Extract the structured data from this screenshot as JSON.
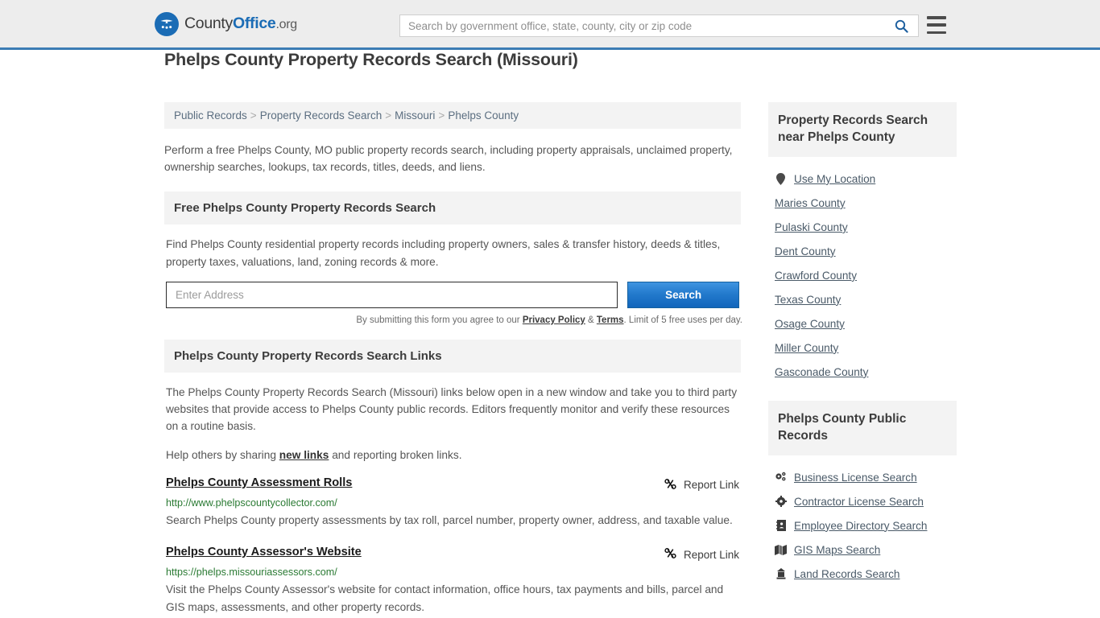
{
  "header": {
    "logo": {
      "part1": "County",
      "part2": "Office",
      "part3": ".org",
      "icon": "eagle-seal-icon"
    },
    "search_placeholder": "Search by government office, state, county, city or zip code",
    "search_value": "",
    "search_icon": "search-icon",
    "menu_icon": "hamburger-menu-icon"
  },
  "page": {
    "title": "Phelps County Property Records Search (Missouri)",
    "breadcrumb": [
      {
        "label": "Public Records"
      },
      {
        "label": "Property Records Search"
      },
      {
        "label": "Missouri"
      },
      {
        "label": "Phelps County"
      }
    ],
    "breadcrumb_separator": ">",
    "intro": "Perform a free Phelps County, MO public property records search, including property appraisals, unclaimed property, ownership searches, lookups, tax records, titles, deeds, and liens."
  },
  "free_search": {
    "heading": "Free Phelps County Property Records Search",
    "description": "Find Phelps County residential property records including property owners, sales & transfer history, deeds & titles, property taxes, valuations, land, zoning records & more.",
    "input_placeholder": "Enter Address",
    "input_value": "",
    "button_label": "Search",
    "note_prefix": "By submitting this form you agree to our ",
    "note_privacy": "Privacy Policy",
    "note_amp": " & ",
    "note_terms": "Terms",
    "note_suffix": ". Limit of 5 free uses per day."
  },
  "links_section": {
    "heading": "Phelps County Property Records Search Links",
    "paragraph": "The Phelps County Property Records Search (Missouri) links below open in a new window and take you to third party websites that provide access to Phelps County public records. Editors frequently monitor and verify these resources on a routine basis.",
    "share_prefix": "Help others by sharing ",
    "share_link": "new links",
    "share_suffix": " and reporting broken links.",
    "report_label": "Report Link",
    "report_icon": "broken-link-icon",
    "results": [
      {
        "title": "Phelps County Assessment Rolls",
        "url": "http://www.phelpscountycollector.com/",
        "description": "Search Phelps County property assessments by tax roll, parcel number, property owner, address, and taxable value."
      },
      {
        "title": "Phelps County Assessor's Website",
        "url": "https://phelps.missouriassessors.com/",
        "description": "Visit the Phelps County Assessor's website for contact information, office hours, tax payments and bills, parcel and GIS maps, assessments, and other property records."
      }
    ]
  },
  "sidebar": {
    "nearby": {
      "heading": "Property Records Search near Phelps County",
      "items": [
        {
          "label": "Use My Location",
          "icon": "map-pin-icon"
        },
        {
          "label": "Maries County",
          "icon": ""
        },
        {
          "label": "Pulaski County",
          "icon": ""
        },
        {
          "label": "Dent County",
          "icon": ""
        },
        {
          "label": "Crawford County",
          "icon": ""
        },
        {
          "label": "Texas County",
          "icon": ""
        },
        {
          "label": "Osage County",
          "icon": ""
        },
        {
          "label": "Miller County",
          "icon": ""
        },
        {
          "label": "Gasconade County",
          "icon": ""
        }
      ]
    },
    "public_records": {
      "heading": "Phelps County Public Records",
      "items": [
        {
          "label": "Business License Search",
          "icon": "cogs-icon"
        },
        {
          "label": "Contractor License Search",
          "icon": "cog-icon"
        },
        {
          "label": "Employee Directory Search",
          "icon": "address-book-icon"
        },
        {
          "label": "GIS Maps Search",
          "icon": "map-icon"
        },
        {
          "label": "Land Records Search",
          "icon": "landmark-icon"
        }
      ]
    }
  },
  "colors": {
    "brand_blue": "#1b6cb5",
    "header_bg": "#ededed",
    "header_border": "#3c7cb4",
    "panel_bg": "#f3f3f3",
    "url_green": "#2a7a33",
    "button_blue": "#2279cc"
  }
}
